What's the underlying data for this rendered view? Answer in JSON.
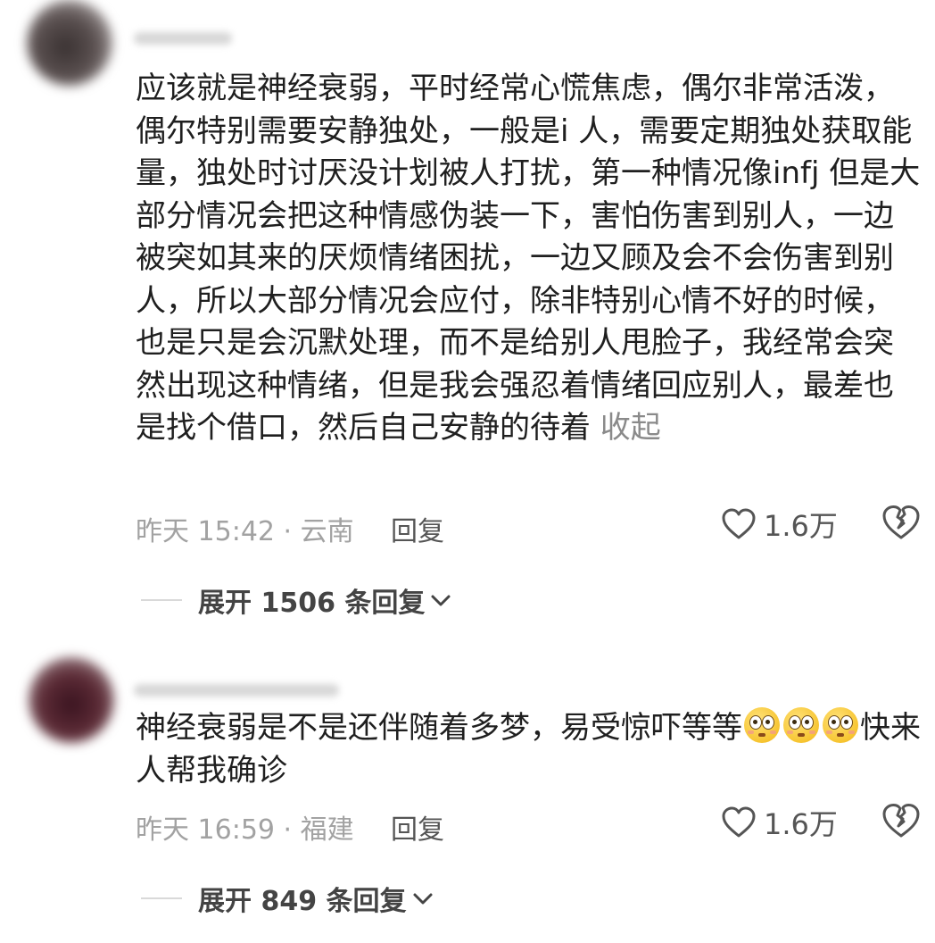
{
  "comments": [
    {
      "text_before": "应该就是神经衰弱，平时经常心慌焦虑，偶尔非常活泼，偶尔特别需要安静独处，一般是i 人，需要定期独处获取能量，独处时讨厌没计划被人打扰，第一种情况像infj 但是大部分情况会把这种情感伪装一下，害怕伤害到别人，一边被突如其来的厌烦情绪困扰，一边又顾及会不会伤害到别人，所以大部分情况会应付，除非特别心情不好的时候，也是只是会沉默处理，而不是给别人甩脸子，我经常会突然出现这种情绪，但是我会强忍着情绪回应别人，最差也是找个借口，然后自己安静的待着",
      "collapse_label": " 收起",
      "time_location": "昨天 15:42 · 云南",
      "reply_label": "回复",
      "likes": "1.6万",
      "expand_label": "展开 1506 条回复"
    },
    {
      "text_before": "神经衰弱是不是还伴随着多梦，易受惊吓等等",
      "emoji": "flushed-face-emoji",
      "text_after": "快来人帮我确诊",
      "time_location": "昨天 16:59 · 福建",
      "reply_label": "回复",
      "likes": "1.6万",
      "expand_label": "展开 849 条回复"
    }
  ],
  "icons": {
    "like": "heart-outline-icon",
    "dislike": "broken-heart-icon",
    "expand": "chevron-down-icon"
  }
}
